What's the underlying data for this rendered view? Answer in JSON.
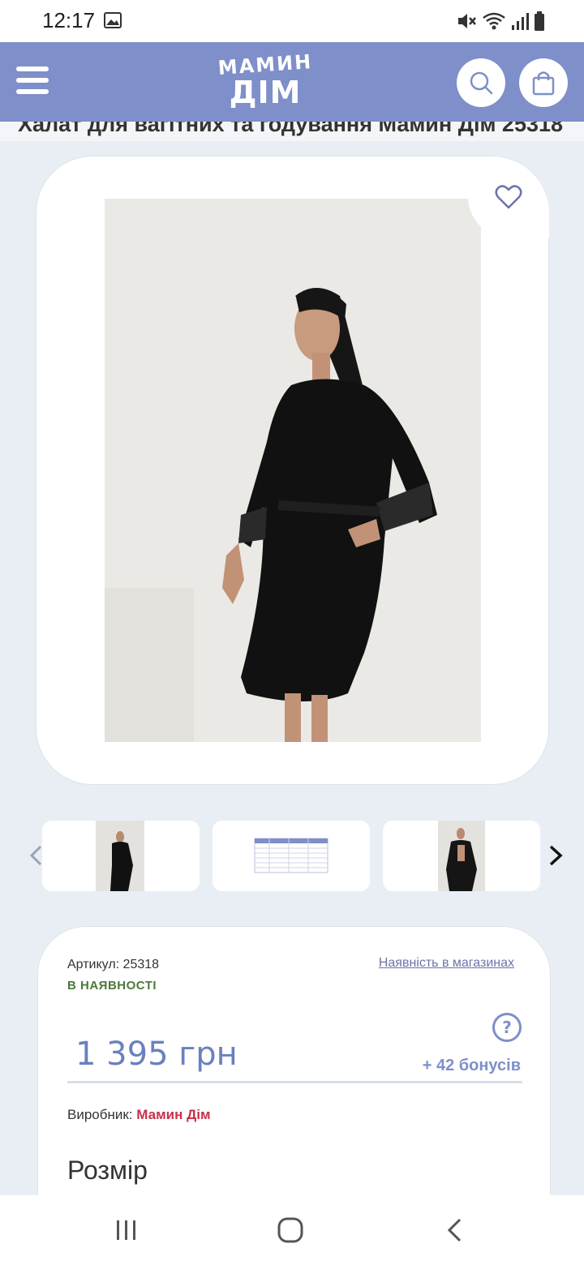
{
  "status_bar": {
    "time": "12:17",
    "icons": [
      "image-icon",
      "mute-icon",
      "wifi-icon",
      "signal-icon",
      "battery-icon"
    ]
  },
  "header": {
    "logo_top": "МАМИН",
    "logo_bottom": "ДІМ",
    "menu_icon": "hamburger-icon",
    "search_icon": "search-icon",
    "cart_icon": "shopping-bag-icon",
    "bg_color": "#7e8fc9"
  },
  "product": {
    "title": "Халат для вагітних та годування Мамин Дім 25318",
    "sku_label": "Артикул: 25318",
    "availability": "В НАЯВНОСТІ",
    "stores_link": "Наявність в магазинах",
    "price": "1 395 грн",
    "bonus": "+ 42 бонусів",
    "help_symbol": "?",
    "manufacturer_label": "Виробник:",
    "manufacturer": "Мамин Дім",
    "size_heading": "Розмір"
  },
  "gallery": {
    "thumbnails": [
      "photo-front",
      "size-table",
      "photo-set"
    ],
    "favorite_icon": "heart-outline-icon"
  },
  "colors": {
    "accent": "#7e8fc9",
    "price": "#6a80c0",
    "in_stock": "#4a7a3a",
    "brand": "#c9304b"
  }
}
